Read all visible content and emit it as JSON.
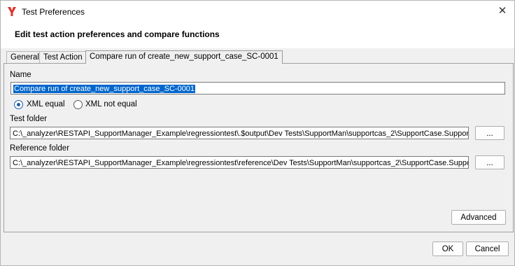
{
  "window": {
    "title": "Test Preferences",
    "header": "Edit test action preferences and compare functions"
  },
  "tabs": [
    {
      "label": "General"
    },
    {
      "label": "Test Action"
    },
    {
      "label": "Compare run of create_new_support_case_SC-0001",
      "active": true
    }
  ],
  "form": {
    "name_label": "Name",
    "name_value": "Compare run of create_new_support_case_SC-0001",
    "radio_xml_equal": "XML equal",
    "radio_xml_not_equal": "XML not equal",
    "selected_radio": "XML equal",
    "test_folder_label": "Test folder",
    "test_folder_value": "C:\\_analyzer\\RESTAPI_SupportManager_Example\\regressiontest\\.$output\\Dev Tests\\SupportMan\\supportcas_2\\SupportCase.Support",
    "reference_folder_label": "Reference folder",
    "reference_folder_value": "C:\\_analyzer\\RESTAPI_SupportManager_Example\\regressiontest\\reference\\Dev Tests\\SupportMan\\supportcas_2\\SupportCase.Suppor",
    "browse_label": "...",
    "advanced_label": "Advanced"
  },
  "footer": {
    "ok_label": "OK",
    "cancel_label": "Cancel"
  },
  "colors": {
    "accent": "#1a5fb4",
    "selection": "#0066cc",
    "logo": "#e0302a"
  },
  "icons": {
    "app": "app-logo-icon",
    "close": "close-icon"
  }
}
